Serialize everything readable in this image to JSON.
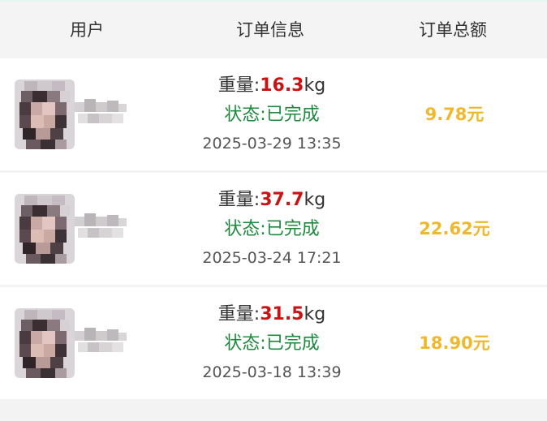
{
  "header": {
    "user_label": "用户",
    "info_label": "订单信息",
    "total_label": "订单总额"
  },
  "orders": [
    {
      "weight_label": "重量:",
      "weight_value": "16.3",
      "weight_unit": "kg",
      "status": "状态:已完成",
      "time": "2025-03-29 13:35",
      "total": "9.78元"
    },
    {
      "weight_label": "重量:",
      "weight_value": "37.7",
      "weight_unit": "kg",
      "status": "状态:已完成",
      "time": "2025-03-24 17:21",
      "total": "22.62元"
    },
    {
      "weight_label": "重量:",
      "weight_value": "31.5",
      "weight_unit": "kg",
      "status": "状态:已完成",
      "time": "2025-03-18 13:39",
      "total": "18.90元"
    }
  ],
  "colors": {
    "weight_value": "#c81414",
    "status": "#1e8a3e",
    "total": "#efb82d"
  }
}
